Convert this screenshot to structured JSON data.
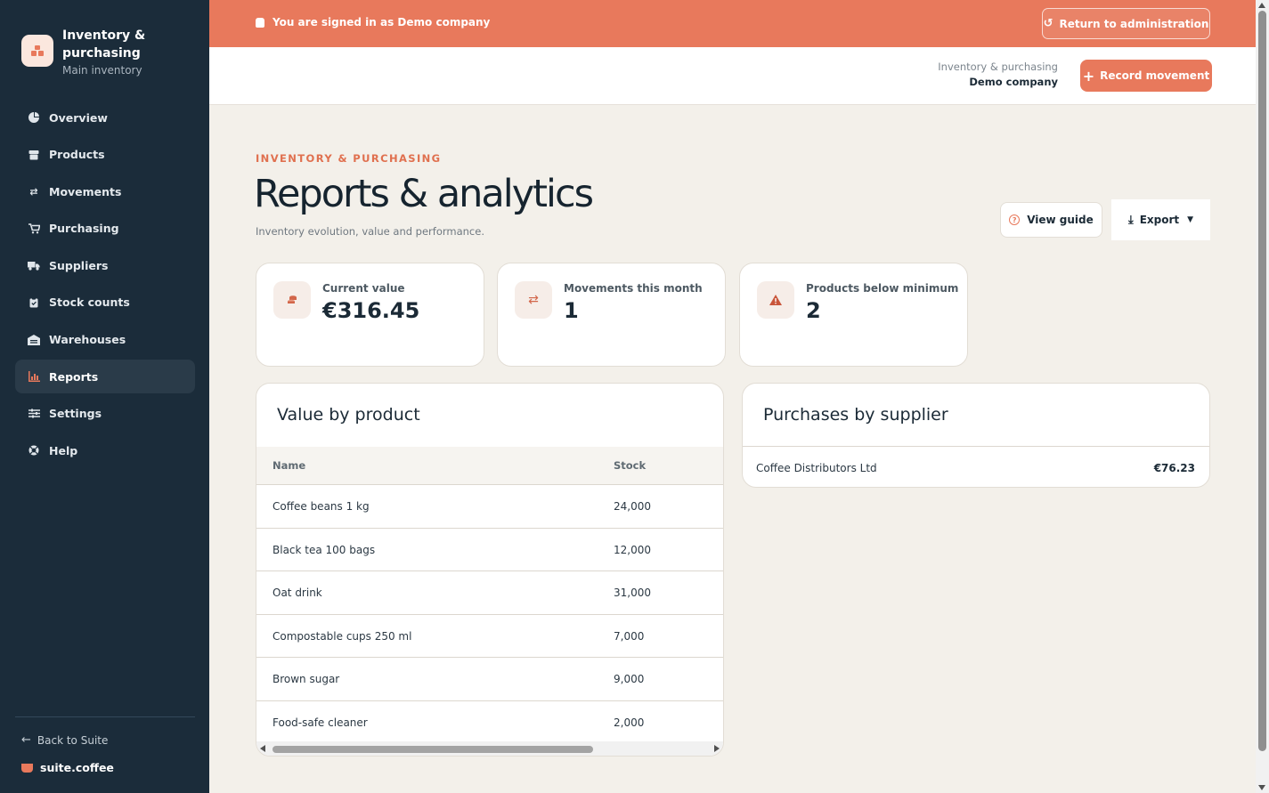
{
  "brand": {
    "title": "Inventory & purchasing",
    "subtitle": "Main inventory"
  },
  "sidebar": {
    "items": [
      {
        "label": "Overview",
        "icon": "pie-chart-icon",
        "active": false
      },
      {
        "label": "Products",
        "icon": "box-icon",
        "active": false
      },
      {
        "label": "Movements",
        "icon": "swap-arrows-icon",
        "active": false
      },
      {
        "label": "Purchasing",
        "icon": "cart-icon",
        "active": false
      },
      {
        "label": "Suppliers",
        "icon": "truck-icon",
        "active": false
      },
      {
        "label": "Stock counts",
        "icon": "clipboard-icon",
        "active": false
      },
      {
        "label": "Warehouses",
        "icon": "warehouse-icon",
        "active": false
      },
      {
        "label": "Reports",
        "icon": "bar-chart-icon",
        "active": true
      },
      {
        "label": "Settings",
        "icon": "sliders-icon",
        "active": false
      },
      {
        "label": "Help",
        "icon": "lifebuoy-icon",
        "active": false
      }
    ],
    "back_label": "Back to Suite",
    "suite_label": "suite.coffee"
  },
  "banner": {
    "text": "You are signed in as Demo company",
    "return_label": "Return to administration"
  },
  "header": {
    "context_line1": "Inventory & purchasing",
    "context_line2": "Demo company",
    "record_label": "Record movement"
  },
  "page": {
    "eyebrow": "INVENTORY & PURCHASING",
    "title": "Reports & analytics",
    "subtitle": "Inventory evolution, value and performance.",
    "guide_label": "View guide",
    "export_label": "Export"
  },
  "kpis": [
    {
      "label": "Current value",
      "value": "€316.45",
      "icon": "coins-icon"
    },
    {
      "label": "Movements this month",
      "value": "1",
      "icon": "swap-arrows-icon"
    },
    {
      "label": "Products below minimum",
      "value": "2",
      "icon": "warning-icon"
    }
  ],
  "value_by_product": {
    "title": "Value by product",
    "columns": [
      "Name",
      "Stock"
    ],
    "rows": [
      {
        "name": "Coffee beans 1 kg",
        "stock": "24,000"
      },
      {
        "name": "Black tea 100 bags",
        "stock": "12,000"
      },
      {
        "name": "Oat drink",
        "stock": "31,000"
      },
      {
        "name": "Compostable cups 250 ml",
        "stock": "7,000"
      },
      {
        "name": "Brown sugar",
        "stock": "9,000"
      },
      {
        "name": "Food-safe cleaner",
        "stock": "2,000"
      }
    ]
  },
  "purchases_by_supplier": {
    "title": "Purchases by supplier",
    "rows": [
      {
        "name": "Coffee Distributors Ltd",
        "value": "€76.23"
      }
    ]
  },
  "colors": {
    "accent": "#e8795c",
    "sidebar_bg": "#1b2c3a",
    "page_bg": "#f3f0ea"
  }
}
